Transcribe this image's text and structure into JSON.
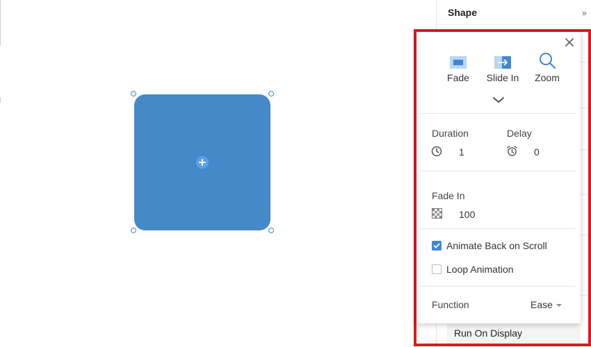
{
  "side_panel": {
    "title": "Shape",
    "run_on_display": "Run On Display"
  },
  "popup": {
    "effects": [
      {
        "label": "Fade",
        "icon": "fade-icon"
      },
      {
        "label": "Slide In",
        "icon": "slide-in-icon"
      },
      {
        "label": "Zoom",
        "icon": "zoom-icon"
      }
    ],
    "duration": {
      "label": "Duration",
      "value": "1"
    },
    "delay": {
      "label": "Delay",
      "value": "0"
    },
    "fade_in": {
      "label": "Fade In",
      "value": "100"
    },
    "animate_back": {
      "label": "Animate Back on Scroll",
      "checked": true
    },
    "loop": {
      "label": "Loop Animation",
      "checked": false
    },
    "function": {
      "label": "Function",
      "value": "Ease"
    }
  },
  "colors": {
    "shape_fill": "#4689c8",
    "accent": "#3f88d6",
    "highlight": "#e0181e"
  }
}
